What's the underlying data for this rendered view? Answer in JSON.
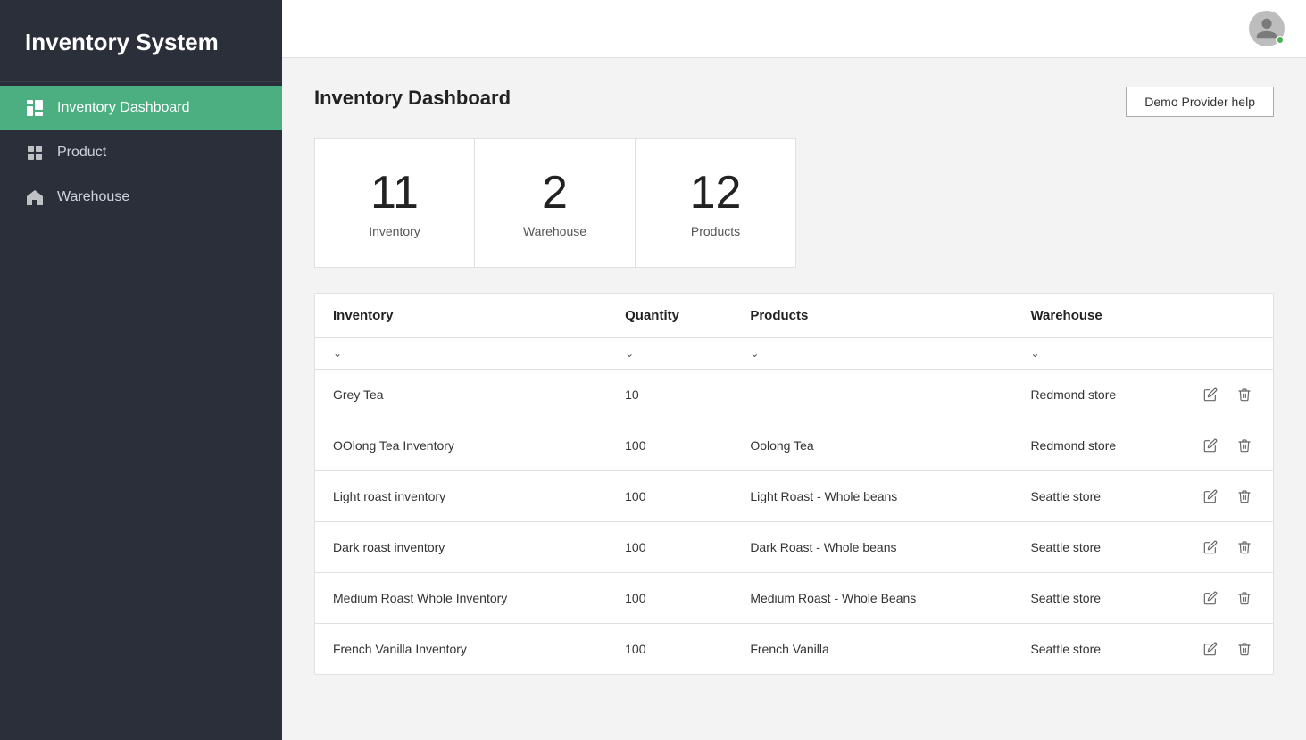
{
  "sidebar": {
    "title": "Inventory System",
    "items": [
      {
        "id": "dashboard",
        "label": "Inventory Dashboard",
        "active": true
      },
      {
        "id": "product",
        "label": "Product",
        "active": false
      },
      {
        "id": "warehouse",
        "label": "Warehouse",
        "active": false
      }
    ]
  },
  "topbar": {
    "help_button": "Demo Provider help"
  },
  "page": {
    "title": "Inventory Dashboard"
  },
  "stats": [
    {
      "number": "11",
      "label": "Inventory"
    },
    {
      "number": "2",
      "label": "Warehouse"
    },
    {
      "number": "12",
      "label": "Products"
    }
  ],
  "table": {
    "columns": [
      {
        "key": "inventory",
        "label": "Inventory"
      },
      {
        "key": "quantity",
        "label": "Quantity"
      },
      {
        "key": "products",
        "label": "Products"
      },
      {
        "key": "warehouse",
        "label": "Warehouse"
      }
    ],
    "rows": [
      {
        "inventory": "Grey Tea",
        "quantity": "10",
        "products": "",
        "warehouse": "Redmond store"
      },
      {
        "inventory": "OOlong Tea Inventory",
        "quantity": "100",
        "products": "Oolong Tea",
        "warehouse": "Redmond store"
      },
      {
        "inventory": "Light roast inventory",
        "quantity": "100",
        "products": "Light Roast - Whole beans",
        "warehouse": "Seattle store"
      },
      {
        "inventory": "Dark roast inventory",
        "quantity": "100",
        "products": "Dark Roast - Whole beans",
        "warehouse": "Seattle store"
      },
      {
        "inventory": "Medium Roast Whole Inventory",
        "quantity": "100",
        "products": "Medium Roast - Whole Beans",
        "warehouse": "Seattle store"
      },
      {
        "inventory": "French Vanilla Inventory",
        "quantity": "100",
        "products": "French Vanilla",
        "warehouse": "Seattle store"
      }
    ]
  },
  "colors": {
    "sidebar_bg": "#2b2f3a",
    "active_green": "#4caf82",
    "status_green": "#4caf50"
  }
}
